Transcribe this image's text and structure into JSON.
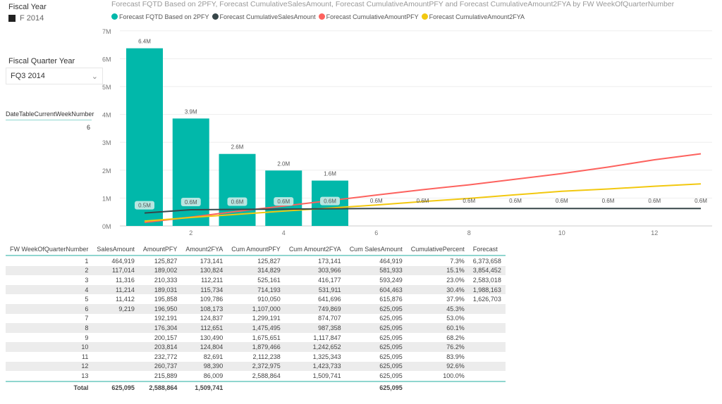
{
  "slicers": {
    "fiscal_year_label": "Fiscal Year",
    "fiscal_year_value": "F 2014",
    "fq_label": "Fiscal Quarter Year",
    "fq_value": "FQ3 2014",
    "week_card_label": "DateTableCurrentWeekNumber",
    "week_card_value": "6"
  },
  "chart_data": {
    "type": "bar+line",
    "title": "Forecast FQTD Based on 2PFY, Forecast CumulativeSalesAmount, Forecast CumulativeAmountPFY and Forecast CumulativeAmount2FYA by FW WeekOfQuarterNumber",
    "xlabel": "FW WeekOfQuarterNumber",
    "ylabel": "",
    "x": [
      1,
      2,
      3,
      4,
      5,
      6,
      7,
      8,
      9,
      10,
      11,
      12,
      13
    ],
    "x_ticks": [
      "2",
      "4",
      "6",
      "8",
      "10",
      "12"
    ],
    "y_ticks": [
      "0M",
      "1M",
      "2M",
      "3M",
      "4M",
      "5M",
      "6M",
      "7M"
    ],
    "ylim": [
      0,
      7000000
    ],
    "series": [
      {
        "name": "Forecast FQTD Based on 2PFY",
        "type": "bar",
        "color": "#01b8aa",
        "values": [
          6373658,
          3854452,
          2583018,
          1988163,
          1626703,
          null,
          null,
          null,
          null,
          null,
          null,
          null,
          null
        ],
        "labels": [
          "6.4M",
          "3.9M",
          "2.6M",
          "2.0M",
          "1.6M"
        ]
      },
      {
        "name": "Forecast CumulativeSalesAmount",
        "type": "line",
        "color": "#374649",
        "values": [
          464919,
          581933,
          593249,
          604463,
          615876,
          625095,
          625095,
          625095,
          625095,
          625095,
          625095,
          625095,
          625095
        ],
        "labels": [
          "0.5M",
          "0.6M",
          "0.6M",
          "0.6M",
          "0.6M",
          "0.6M",
          "0.6M",
          "0.6M",
          "0.6M",
          "0.6M",
          "0.6M",
          "0.6M",
          "0.6M"
        ]
      },
      {
        "name": "Forecast CumulativeAmountPFY",
        "type": "line",
        "color": "#fd625e",
        "values": [
          125827,
          314829,
          525161,
          714193,
          910050,
          1107000,
          1299191,
          1475495,
          1675651,
          1879466,
          2112238,
          2372975,
          2588864
        ]
      },
      {
        "name": "Forecast CumulativeAmount2FYA",
        "type": "line",
        "color": "#f2c80f",
        "values": [
          173141,
          303966,
          416177,
          531911,
          641696,
          749869,
          874707,
          987358,
          1117847,
          1242652,
          1325343,
          1423733,
          1509741
        ]
      }
    ]
  },
  "table": {
    "headers": [
      "FW WeekOfQuarterNumber",
      "SalesAmount",
      "AmountPFY",
      "Amount2FYA",
      "Cum AmountPFY",
      "Cum Amount2FYA",
      "Cum SalesAmount",
      "CumulativePercent",
      "Forecast"
    ],
    "rows": [
      [
        "1",
        "464,919",
        "125,827",
        "173,141",
        "125,827",
        "173,141",
        "464,919",
        "7.3%",
        "6,373,658"
      ],
      [
        "2",
        "117,014",
        "189,002",
        "130,824",
        "314,829",
        "303,966",
        "581,933",
        "15.1%",
        "3,854,452"
      ],
      [
        "3",
        "11,316",
        "210,333",
        "112,211",
        "525,161",
        "416,177",
        "593,249",
        "23.0%",
        "2,583,018"
      ],
      [
        "4",
        "11,214",
        "189,031",
        "115,734",
        "714,193",
        "531,911",
        "604,463",
        "30.4%",
        "1,988,163"
      ],
      [
        "5",
        "11,412",
        "195,858",
        "109,786",
        "910,050",
        "641,696",
        "615,876",
        "37.9%",
        "1,626,703"
      ],
      [
        "6",
        "9,219",
        "196,950",
        "108,173",
        "1,107,000",
        "749,869",
        "625,095",
        "45.3%",
        ""
      ],
      [
        "7",
        "",
        "192,191",
        "124,837",
        "1,299,191",
        "874,707",
        "625,095",
        "53.0%",
        ""
      ],
      [
        "8",
        "",
        "176,304",
        "112,651",
        "1,475,495",
        "987,358",
        "625,095",
        "60.1%",
        ""
      ],
      [
        "9",
        "",
        "200,157",
        "130,490",
        "1,675,651",
        "1,117,847",
        "625,095",
        "68.2%",
        ""
      ],
      [
        "10",
        "",
        "203,814",
        "124,804",
        "1,879,466",
        "1,242,652",
        "625,095",
        "76.2%",
        ""
      ],
      [
        "11",
        "",
        "232,772",
        "82,691",
        "2,112,238",
        "1,325,343",
        "625,095",
        "83.9%",
        ""
      ],
      [
        "12",
        "",
        "260,737",
        "98,390",
        "2,372,975",
        "1,423,733",
        "625,095",
        "92.6%",
        ""
      ],
      [
        "13",
        "",
        "215,889",
        "86,009",
        "2,588,864",
        "1,509,741",
        "625,095",
        "100.0%",
        ""
      ]
    ],
    "total": [
      "Total",
      "625,095",
      "2,588,864",
      "1,509,741",
      "",
      "",
      "625,095",
      "",
      ""
    ]
  }
}
